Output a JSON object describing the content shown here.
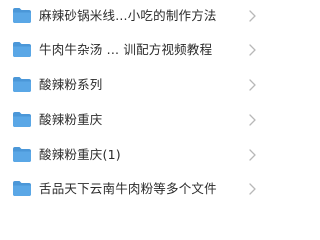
{
  "files": [
    {
      "name": "麻辣砂锅米线...小吃的制作方法",
      "icon": "folder-icon"
    },
    {
      "name": "牛肉牛杂汤 ... 训配方视频教程",
      "icon": "folder-icon"
    },
    {
      "name": "酸辣粉系列",
      "icon": "folder-icon"
    },
    {
      "name": "酸辣粉重庆",
      "icon": "folder-icon"
    },
    {
      "name": "酸辣粉重庆(1)",
      "icon": "folder-icon"
    },
    {
      "name": "舌品天下云南牛肉粉等多个文件",
      "icon": "folder-icon"
    }
  ],
  "colors": {
    "folder": "#5aa7e6",
    "folder_tab": "#4b97d8",
    "chevron": "#b8b8b8",
    "text": "#2b2b2b"
  }
}
